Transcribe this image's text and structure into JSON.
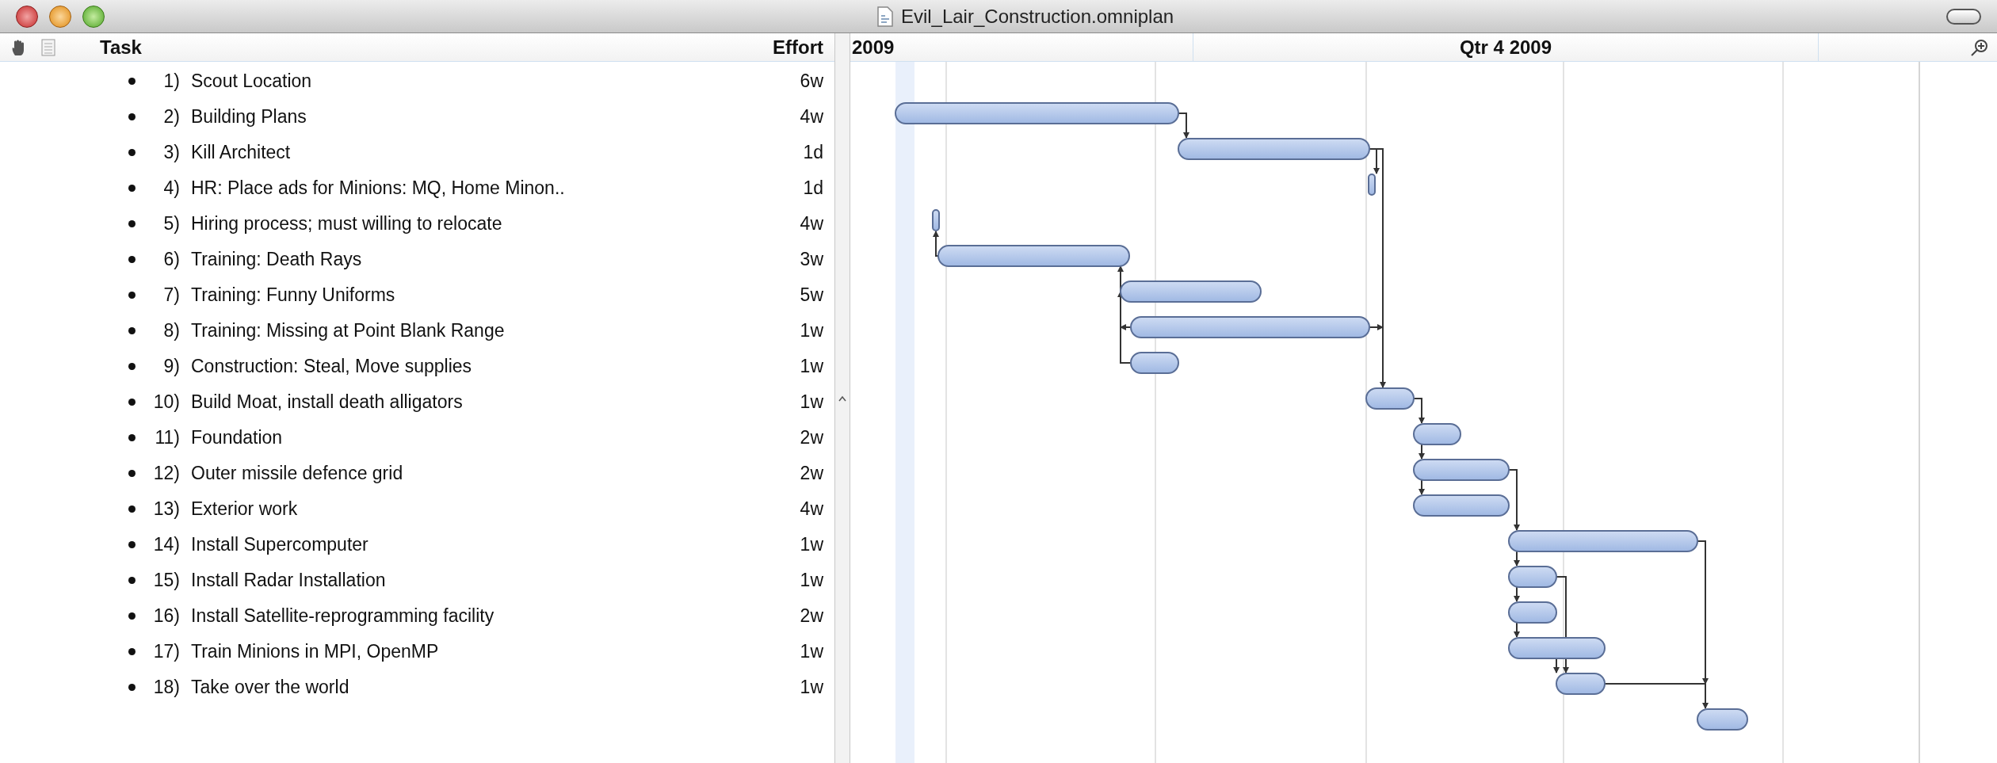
{
  "window": {
    "title": "Evil_Lair_Construction.omniplan"
  },
  "columns": {
    "task": "Task",
    "effort": "Effort"
  },
  "timeline": {
    "headers": [
      "2009",
      "Qtr 4 2009"
    ]
  },
  "tasks": [
    {
      "number": "1)",
      "name": "Scout Location",
      "effort": "6w"
    },
    {
      "number": "2)",
      "name": "Building Plans",
      "effort": "4w"
    },
    {
      "number": "3)",
      "name": "Kill Architect",
      "effort": "1d"
    },
    {
      "number": "4)",
      "name": "HR: Place ads for Minions: MQ, Home Minon..",
      "effort": "1d"
    },
    {
      "number": "5)",
      "name": "Hiring process; must willing to relocate",
      "effort": "4w"
    },
    {
      "number": "6)",
      "name": "Training: Death Rays",
      "effort": "3w"
    },
    {
      "number": "7)",
      "name": "Training: Funny Uniforms",
      "effort": "5w"
    },
    {
      "number": "8)",
      "name": "Training: Missing at Point Blank Range",
      "effort": "1w"
    },
    {
      "number": "9)",
      "name": "Construction: Steal, Move supplies",
      "effort": "1w"
    },
    {
      "number": "10)",
      "name": "Build Moat, install death alligators",
      "effort": "1w"
    },
    {
      "number": "11)",
      "name": "Foundation",
      "effort": "2w"
    },
    {
      "number": "12)",
      "name": "Outer missile defence grid",
      "effort": "2w"
    },
    {
      "number": "13)",
      "name": "Exterior work",
      "effort": "4w"
    },
    {
      "number": "14)",
      "name": "Install Supercomputer",
      "effort": "1w"
    },
    {
      "number": "15)",
      "name": "Install Radar Installation",
      "effort": "1w"
    },
    {
      "number": "16)",
      "name": "Install Satellite-reprogramming facility",
      "effort": "2w"
    },
    {
      "number": "17)",
      "name": "Train Minions in MPI, OpenMP",
      "effort": "1w"
    },
    {
      "number": "18)",
      "name": "Take over the world",
      "effort": "1w"
    }
  ]
}
